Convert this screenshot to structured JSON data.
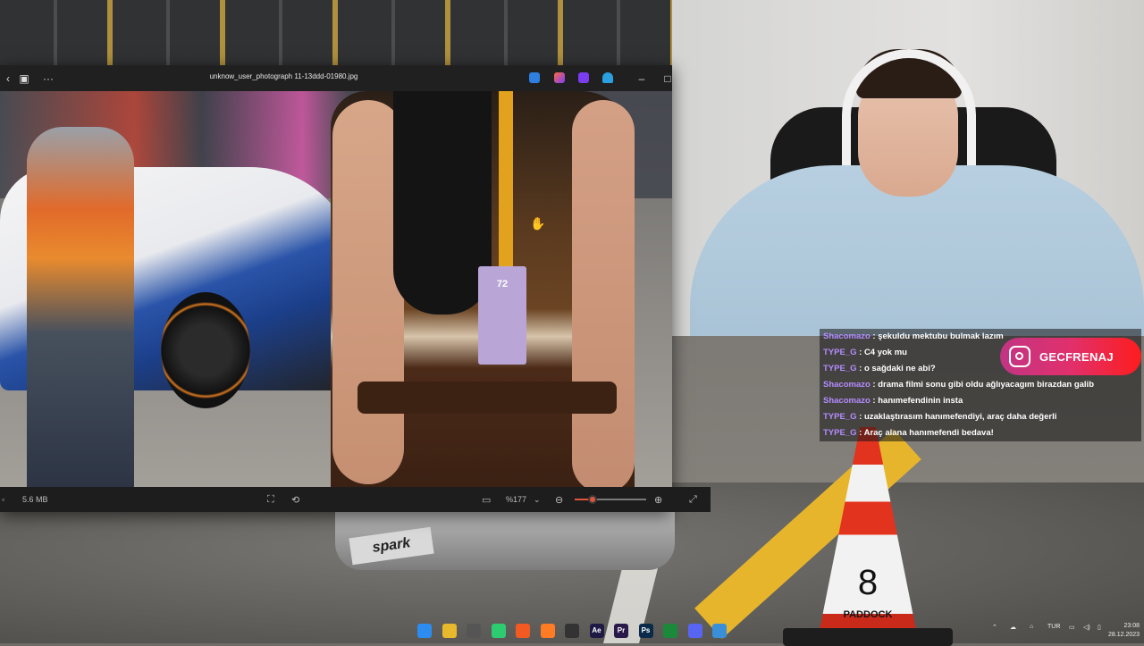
{
  "viewer": {
    "filename": "unknow_user_photograph 11-13ddd-01980.jpg",
    "file_size": "5.6 MB",
    "zoom_percent": "%177",
    "zoom_level": 0.25,
    "photo_overlay": {
      "badge_text": "72",
      "brand_text": "spark"
    }
  },
  "chat": {
    "messages": [
      {
        "user": "Shacomazo",
        "text": " : şekuldu mektubu bulmak lazım"
      },
      {
        "user": "TYPE_G",
        "text": " : C4 yok mu"
      },
      {
        "user": "TYPE_G",
        "text": " : o sağdaki ne abi?"
      },
      {
        "user": "Shacomazo",
        "text": " : drama filmi sonu gibi oldu ağlıyacagım birazdan galib"
      },
      {
        "user": "Shacomazo",
        "text": " : hanımefendinin insta"
      },
      {
        "user": "TYPE_G",
        "text": " : uzaklaştırasım hanımefendiyi, araç daha değerli"
      },
      {
        "user": "TYPE_G",
        "text": " : Araç alana hanımefendi bedava!"
      }
    ]
  },
  "instagram": {
    "handle": "GECFRENAJ"
  },
  "cone": {
    "number": "8",
    "label": "PADDOCK"
  },
  "taskbar": {
    "apps": [
      {
        "name": "start-icon",
        "label": "",
        "color": "#2d8cf0"
      },
      {
        "name": "file-explorer-icon",
        "label": "",
        "color": "#e8b92d"
      },
      {
        "name": "editor-icon",
        "label": "",
        "color": "#555"
      },
      {
        "name": "whatsapp-icon",
        "label": "",
        "color": "#2ecc71"
      },
      {
        "name": "brave-icon",
        "label": "",
        "color": "#f25a22"
      },
      {
        "name": "firefox-icon",
        "label": "",
        "color": "#ff7b24"
      },
      {
        "name": "obs-icon",
        "label": "",
        "color": "#333"
      },
      {
        "name": "after-effects-icon",
        "label": "Ae",
        "color": "#1f1a45"
      },
      {
        "name": "premiere-icon",
        "label": "Pr",
        "color": "#2a1a4a"
      },
      {
        "name": "photoshop-icon",
        "label": "Ps",
        "color": "#0b2a4a"
      },
      {
        "name": "terminal-icon",
        "label": "",
        "color": "#1a8a3a"
      },
      {
        "name": "discord-icon",
        "label": "",
        "color": "#5865f2"
      },
      {
        "name": "photos-icon",
        "label": "",
        "color": "#3a8fd8"
      }
    ],
    "tray_language": "TUR",
    "clock_time": "23:08",
    "clock_date": "28.12.2023"
  },
  "colors": {
    "accent_zoom": "#e0553a",
    "chat_user": "#b48cff",
    "instagram_gradient": "#e1306c"
  }
}
